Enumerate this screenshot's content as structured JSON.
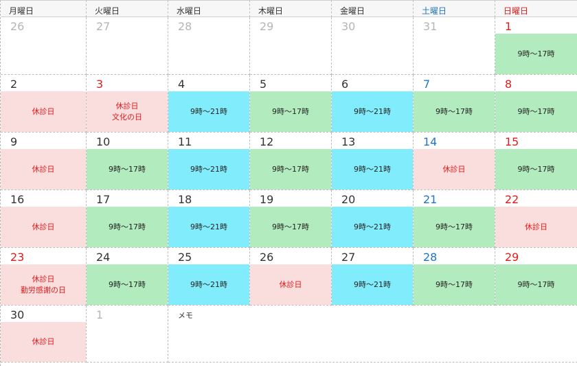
{
  "weekdays": [
    {
      "label": "月曜日",
      "kind": "weekday"
    },
    {
      "label": "火曜日",
      "kind": "weekday"
    },
    {
      "label": "水曜日",
      "kind": "weekday"
    },
    {
      "label": "木曜日",
      "kind": "weekday"
    },
    {
      "label": "金曜日",
      "kind": "weekday"
    },
    {
      "label": "土曜日",
      "kind": "sat"
    },
    {
      "label": "日曜日",
      "kind": "sun"
    }
  ],
  "days": [
    {
      "day": "26",
      "numStyle": "other",
      "band": "",
      "lines": []
    },
    {
      "day": "27",
      "numStyle": "other",
      "band": "",
      "lines": []
    },
    {
      "day": "28",
      "numStyle": "other",
      "band": "",
      "lines": []
    },
    {
      "day": "29",
      "numStyle": "other",
      "band": "",
      "lines": []
    },
    {
      "day": "30",
      "numStyle": "other",
      "band": "",
      "lines": []
    },
    {
      "day": "31",
      "numStyle": "other",
      "band": "",
      "lines": []
    },
    {
      "day": "1",
      "numStyle": "red",
      "band": "open17",
      "lines": [
        "9時～17時"
      ]
    },
    {
      "day": "2",
      "numStyle": "normal",
      "band": "closed",
      "lines": [
        "休診日"
      ]
    },
    {
      "day": "3",
      "numStyle": "red",
      "band": "closed",
      "lines": [
        "休診日",
        "文化の日"
      ]
    },
    {
      "day": "4",
      "numStyle": "normal",
      "band": "open21",
      "lines": [
        "9時～21時"
      ]
    },
    {
      "day": "5",
      "numStyle": "normal",
      "band": "open17",
      "lines": [
        "9時～17時"
      ]
    },
    {
      "day": "6",
      "numStyle": "normal",
      "band": "open21",
      "lines": [
        "9時～21時"
      ]
    },
    {
      "day": "7",
      "numStyle": "sat",
      "band": "open17",
      "lines": [
        "9時～17時"
      ]
    },
    {
      "day": "8",
      "numStyle": "red",
      "band": "open17",
      "lines": [
        "9時～17時"
      ]
    },
    {
      "day": "9",
      "numStyle": "normal",
      "band": "closed",
      "lines": [
        "休診日"
      ]
    },
    {
      "day": "10",
      "numStyle": "normal",
      "band": "open17",
      "lines": [
        "9時～17時"
      ]
    },
    {
      "day": "11",
      "numStyle": "normal",
      "band": "open21",
      "lines": [
        "9時～21時"
      ]
    },
    {
      "day": "12",
      "numStyle": "normal",
      "band": "open17",
      "lines": [
        "9時～17時"
      ]
    },
    {
      "day": "13",
      "numStyle": "normal",
      "band": "open21",
      "lines": [
        "9時～21時"
      ]
    },
    {
      "day": "14",
      "numStyle": "sat",
      "band": "closed",
      "lines": [
        "休診日"
      ]
    },
    {
      "day": "15",
      "numStyle": "red",
      "band": "open17",
      "lines": [
        "9時～17時"
      ]
    },
    {
      "day": "16",
      "numStyle": "normal",
      "band": "closed",
      "lines": [
        "休診日"
      ]
    },
    {
      "day": "17",
      "numStyle": "normal",
      "band": "open17",
      "lines": [
        "9時～17時"
      ]
    },
    {
      "day": "18",
      "numStyle": "normal",
      "band": "open21",
      "lines": [
        "9時～21時"
      ]
    },
    {
      "day": "19",
      "numStyle": "normal",
      "band": "open17",
      "lines": [
        "9時～17時"
      ]
    },
    {
      "day": "20",
      "numStyle": "normal",
      "band": "open21",
      "lines": [
        "9時～21時"
      ]
    },
    {
      "day": "21",
      "numStyle": "sat",
      "band": "open17",
      "lines": [
        "9時～17時"
      ]
    },
    {
      "day": "22",
      "numStyle": "red",
      "band": "closed",
      "lines": [
        "休診日"
      ]
    },
    {
      "day": "23",
      "numStyle": "red",
      "band": "closed",
      "lines": [
        "休診日",
        "勤労感謝の日"
      ]
    },
    {
      "day": "24",
      "numStyle": "normal",
      "band": "open17",
      "lines": [
        "9時～17時"
      ]
    },
    {
      "day": "25",
      "numStyle": "normal",
      "band": "open21",
      "lines": [
        "9時～21時"
      ]
    },
    {
      "day": "26",
      "numStyle": "normal",
      "band": "closed",
      "lines": [
        "休診日"
      ]
    },
    {
      "day": "27",
      "numStyle": "normal",
      "band": "open21",
      "lines": [
        "9時～21時"
      ]
    },
    {
      "day": "28",
      "numStyle": "sat",
      "band": "open17",
      "lines": [
        "9時～17時"
      ]
    },
    {
      "day": "29",
      "numStyle": "red",
      "band": "open17",
      "lines": [
        "9時～17時"
      ]
    },
    {
      "day": "30",
      "numStyle": "normal",
      "band": "closed",
      "lines": [
        "休診日"
      ]
    },
    {
      "day": "1",
      "numStyle": "other",
      "band": "",
      "lines": []
    }
  ],
  "memo": {
    "label": "メモ"
  },
  "colors": {
    "open_9_17": "#b2ecbe",
    "open_9_21": "#81edfc",
    "closed": "#fadddd",
    "holiday_text": "#e11a1a",
    "saturday_text": "#1f74c4"
  }
}
